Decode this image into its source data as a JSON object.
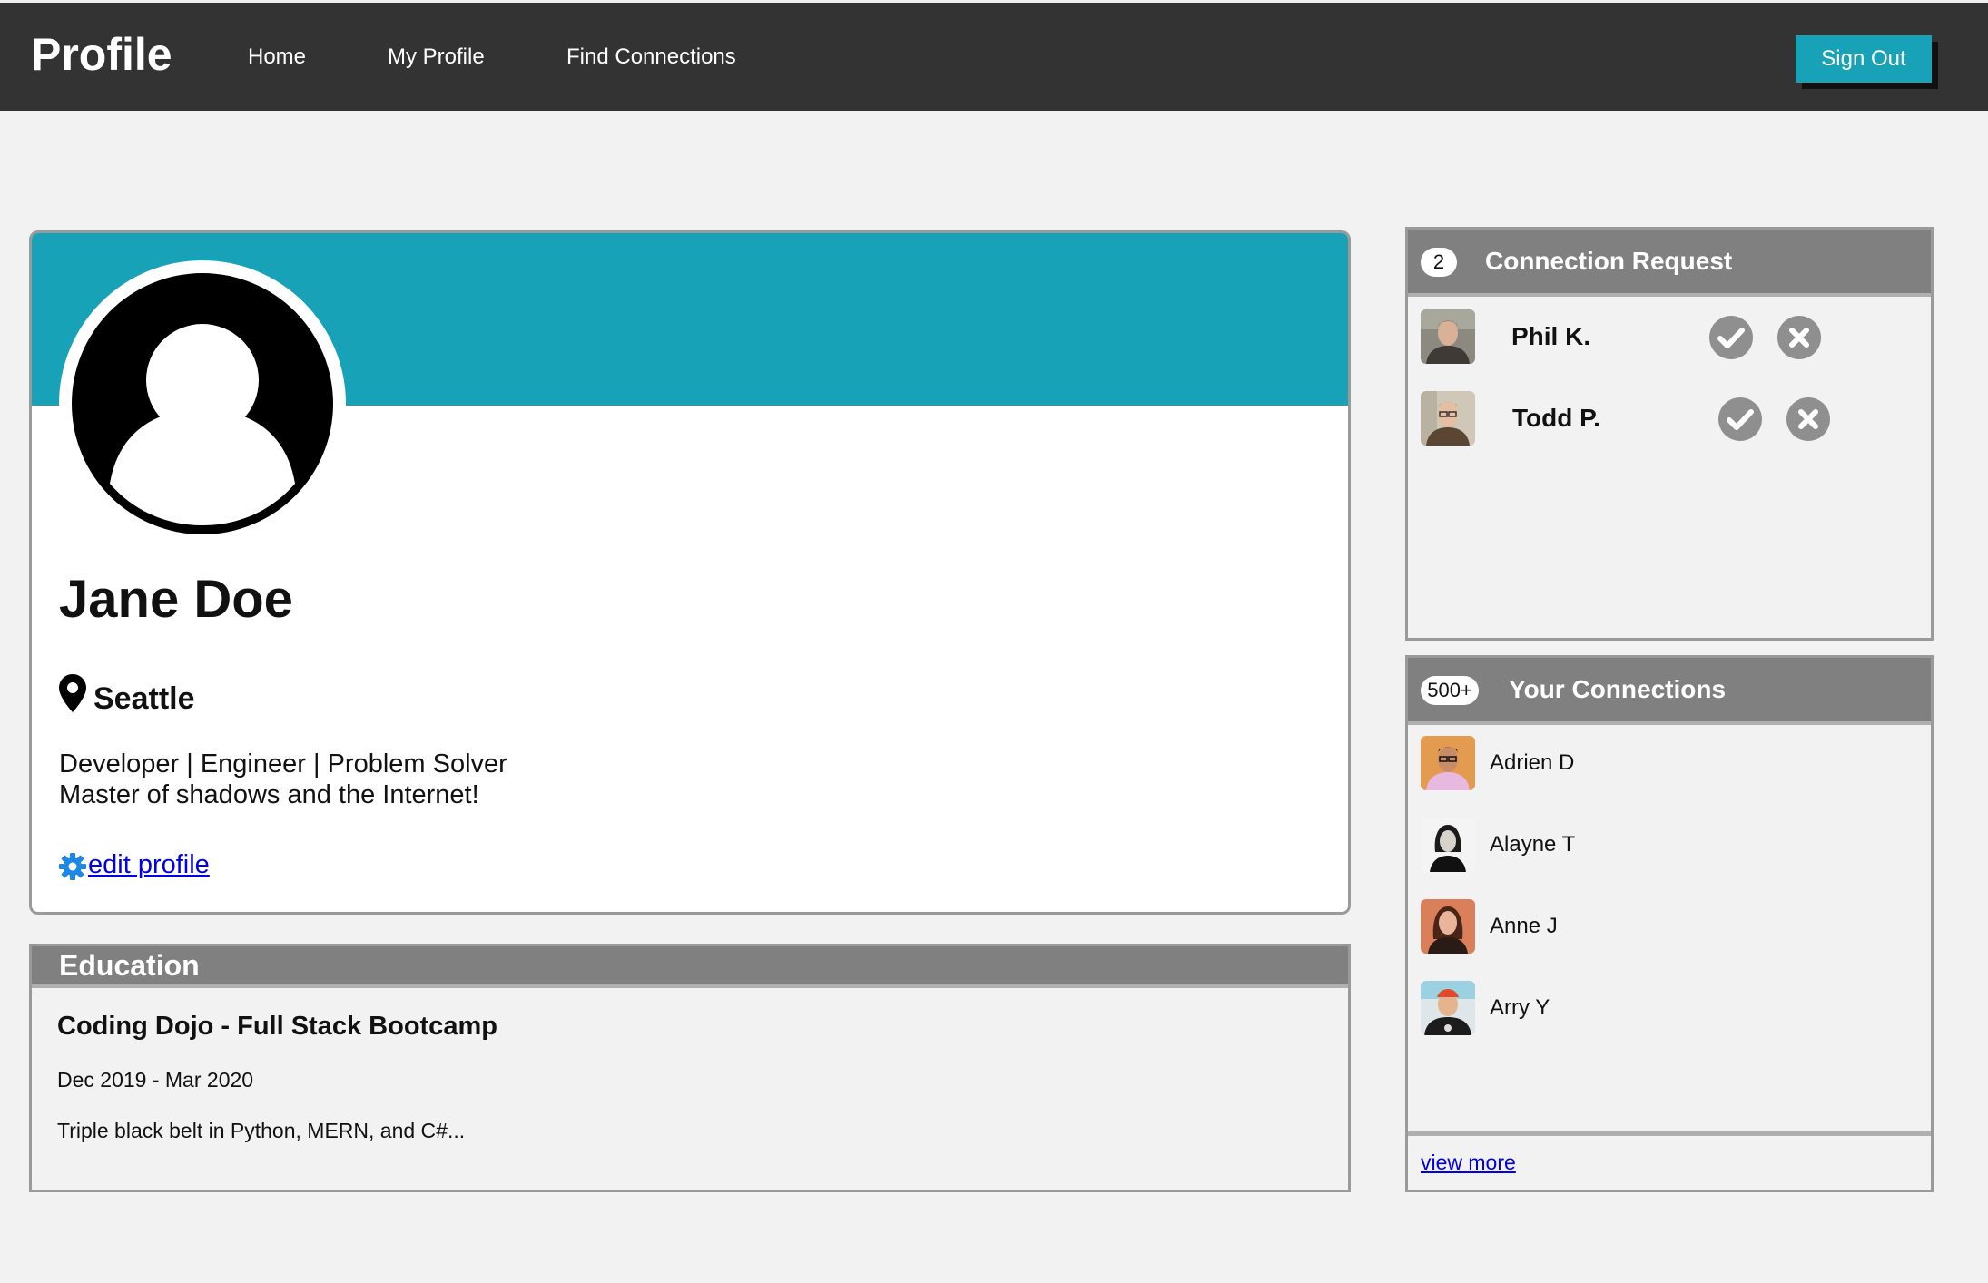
{
  "nav": {
    "brand": "Profile",
    "links": [
      "Home",
      "My Profile",
      "Find Connections"
    ],
    "signout_label": "Sign Out"
  },
  "profile": {
    "name": "Jane Doe",
    "location": "Seattle",
    "bio_line1": "Developer | Engineer | Problem Solver",
    "bio_line2": "Master of shadows and the Internet!",
    "edit_label": " edit profile",
    "banner_color": "#17a2b8"
  },
  "education": {
    "title": "Education",
    "school": "Coding Dojo - Full Stack Bootcamp",
    "dates": "Dec 2019 - Mar 2020",
    "description": "Triple black belt in Python, MERN, and C#..."
  },
  "requests": {
    "count": "2",
    "title": "Connection Request",
    "items": [
      {
        "name": "Phil K."
      },
      {
        "name": "Todd P."
      }
    ]
  },
  "connections": {
    "count": "500+",
    "title": "Your Connections",
    "items": [
      {
        "name": "Adrien D"
      },
      {
        "name": "Alayne T"
      },
      {
        "name": "Anne J"
      },
      {
        "name": "Arry Y"
      }
    ],
    "view_more": "view more"
  },
  "icons": {
    "location": "map-pin-icon",
    "edit": "gear-icon",
    "accept": "check-circle-icon",
    "decline": "x-circle-icon"
  }
}
